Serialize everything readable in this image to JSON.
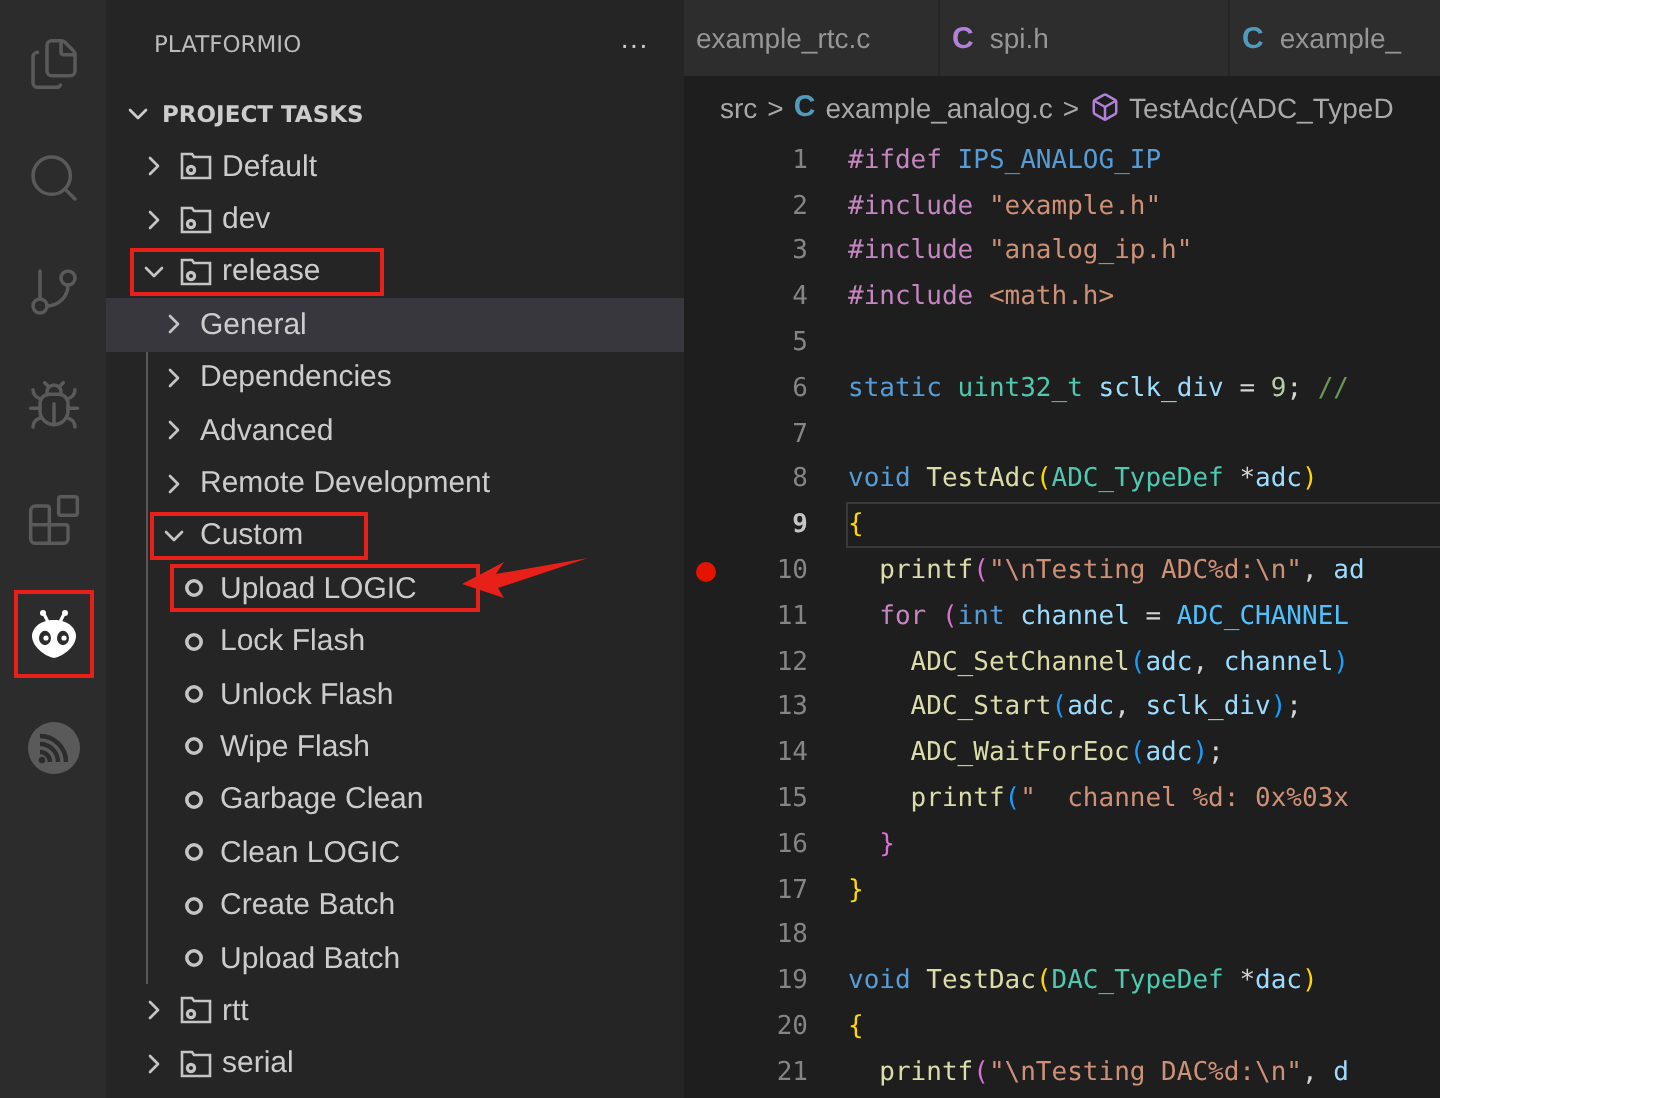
{
  "activity_bar": [
    {
      "selected": false,
      "highlighted": false
    },
    {
      "selected": false,
      "highlighted": false
    },
    {
      "selected": false,
      "highlighted": false
    },
    {
      "selected": false,
      "highlighted": false
    },
    {
      "selected": false,
      "highlighted": false
    },
    {
      "selected": true,
      "highlighted": true
    },
    {
      "selected": false,
      "highlighted": false
    }
  ],
  "sidebar": {
    "title": "PLATFORMIO",
    "more": "···",
    "section": {
      "title": "PROJECT TASKS",
      "expanded": true,
      "items": [
        {
          "kind": "env",
          "label": "Default",
          "expanded": false,
          "selected": false,
          "highlighted": false
        },
        {
          "kind": "env",
          "label": "dev",
          "expanded": false,
          "selected": false,
          "highlighted": false
        },
        {
          "kind": "env",
          "label": "release",
          "expanded": true,
          "selected": false,
          "highlighted": true,
          "children": [
            {
              "kind": "group",
              "label": "General",
              "expanded": false,
              "selected": true,
              "highlighted": false
            },
            {
              "kind": "group",
              "label": "Dependencies",
              "expanded": false,
              "selected": false,
              "highlighted": false
            },
            {
              "kind": "group",
              "label": "Advanced",
              "expanded": false,
              "selected": false,
              "highlighted": false
            },
            {
              "kind": "group",
              "label": "Remote Development",
              "expanded": false,
              "selected": false,
              "highlighted": false
            },
            {
              "kind": "group",
              "label": "Custom",
              "expanded": true,
              "selected": false,
              "highlighted": true,
              "children": [
                {
                  "kind": "task",
                  "label": "Upload LOGIC",
                  "selected": false,
                  "highlighted": true,
                  "arrow": true
                },
                {
                  "kind": "task",
                  "label": "Lock Flash",
                  "selected": false,
                  "highlighted": false
                },
                {
                  "kind": "task",
                  "label": "Unlock Flash",
                  "selected": false,
                  "highlighted": false
                },
                {
                  "kind": "task",
                  "label": "Wipe Flash",
                  "selected": false,
                  "highlighted": false
                },
                {
                  "kind": "task",
                  "label": "Garbage Clean",
                  "selected": false,
                  "highlighted": false
                },
                {
                  "kind": "task",
                  "label": "Clean LOGIC",
                  "selected": false,
                  "highlighted": false
                },
                {
                  "kind": "task",
                  "label": "Create Batch",
                  "selected": false,
                  "highlighted": false
                },
                {
                  "kind": "task",
                  "label": "Upload Batch",
                  "selected": false,
                  "highlighted": false
                }
              ]
            }
          ]
        },
        {
          "kind": "env",
          "label": "rtt",
          "expanded": false,
          "selected": false,
          "highlighted": false
        },
        {
          "kind": "env",
          "label": "serial",
          "expanded": false,
          "selected": false,
          "highlighted": false
        }
      ]
    }
  },
  "editor": {
    "tabs": [
      {
        "label": "example_rtc.c",
        "icon": false
      },
      {
        "label": "spi.h",
        "icon": true,
        "icon_text": "C",
        "color": "#b180d7"
      },
      {
        "label": "example_",
        "icon": true,
        "icon_text": "C",
        "color": "#519aba"
      }
    ],
    "breadcrumb": {
      "folder": "src",
      "separator": ">",
      "file_icon": "C",
      "file": "example_analog.c",
      "symbol": "TestAdc(ADC_TypeD"
    },
    "lines": [
      {
        "number": "1",
        "breakpoint": false,
        "current": false,
        "tokens": [
          {
            "kind": "preproc",
            "text": "#ifdef "
          },
          {
            "kind": "macro",
            "text": "IPS_ANALOG_IP"
          }
        ]
      },
      {
        "number": "2",
        "breakpoint": false,
        "current": false,
        "tokens": [
          {
            "kind": "preproc",
            "text": "#include "
          },
          {
            "kind": "string",
            "text": "\"example.h\""
          }
        ]
      },
      {
        "number": "3",
        "breakpoint": false,
        "current": false,
        "tokens": [
          {
            "kind": "preproc",
            "text": "#include "
          },
          {
            "kind": "string",
            "text": "\"analog_ip.h\""
          }
        ]
      },
      {
        "number": "4",
        "breakpoint": false,
        "current": false,
        "tokens": [
          {
            "kind": "preproc",
            "text": "#include "
          },
          {
            "kind": "string",
            "text": "<math.h>"
          }
        ]
      },
      {
        "number": "5",
        "breakpoint": false,
        "current": false
      },
      {
        "number": "6",
        "breakpoint": false,
        "current": false,
        "tokens": [
          {
            "kind": "keyword",
            "text": "static "
          },
          {
            "kind": "type",
            "text": "uint32_t "
          },
          {
            "kind": "variable",
            "text": "sclk_div"
          },
          {
            "kind": "plain",
            "text": " = "
          },
          {
            "kind": "number",
            "text": "9"
          },
          {
            "kind": "plain",
            "text": "; "
          },
          {
            "kind": "comment",
            "text": "//"
          }
        ]
      },
      {
        "number": "7",
        "breakpoint": false,
        "current": false
      },
      {
        "number": "8",
        "breakpoint": false,
        "current": false,
        "tokens": [
          {
            "kind": "keyword",
            "text": "void "
          },
          {
            "kind": "function",
            "text": "TestAdc"
          },
          {
            "kind": "bracket1",
            "text": "("
          },
          {
            "kind": "type",
            "text": "ADC_TypeDef "
          },
          {
            "kind": "plain",
            "text": "*"
          },
          {
            "kind": "variable",
            "text": "adc"
          },
          {
            "kind": "bracket1",
            "text": ")"
          }
        ]
      },
      {
        "number": "9",
        "breakpoint": false,
        "current": true,
        "tokens": [
          {
            "kind": "bracket1",
            "text": "{"
          }
        ]
      },
      {
        "number": "10",
        "breakpoint": true,
        "current": false,
        "tokens": [
          {
            "kind": "function",
            "text": "  printf"
          },
          {
            "kind": "bracket2",
            "text": "("
          },
          {
            "kind": "string",
            "text": "\"\\nTesting ADC%d:\\n\""
          },
          {
            "kind": "plain",
            "text": ", "
          },
          {
            "kind": "variable",
            "text": "ad"
          }
        ]
      },
      {
        "number": "11",
        "breakpoint": false,
        "current": false,
        "tokens": [
          {
            "kind": "control",
            "text": "  for "
          },
          {
            "kind": "bracket2",
            "text": "("
          },
          {
            "kind": "keyword",
            "text": "int "
          },
          {
            "kind": "variable",
            "text": "channel"
          },
          {
            "kind": "plain",
            "text": " = "
          },
          {
            "kind": "constant",
            "text": "ADC_CHANNEL"
          }
        ]
      },
      {
        "number": "12",
        "breakpoint": false,
        "current": false,
        "tokens": [
          {
            "kind": "function",
            "text": "    ADC_SetChannel"
          },
          {
            "kind": "bracket3",
            "text": "("
          },
          {
            "kind": "variable",
            "text": "adc"
          },
          {
            "kind": "plain",
            "text": ", "
          },
          {
            "kind": "variable",
            "text": "channel"
          },
          {
            "kind": "bracket3",
            "text": ")"
          }
        ]
      },
      {
        "number": "13",
        "breakpoint": false,
        "current": false,
        "tokens": [
          {
            "kind": "function",
            "text": "    ADC_Start"
          },
          {
            "kind": "bracket3",
            "text": "("
          },
          {
            "kind": "variable",
            "text": "adc"
          },
          {
            "kind": "plain",
            "text": ", "
          },
          {
            "kind": "variable",
            "text": "sclk_div"
          },
          {
            "kind": "bracket3",
            "text": ")"
          },
          {
            "kind": "plain",
            "text": ";"
          }
        ]
      },
      {
        "number": "14",
        "breakpoint": false,
        "current": false,
        "tokens": [
          {
            "kind": "function",
            "text": "    ADC_WaitForEoc"
          },
          {
            "kind": "bracket3",
            "text": "("
          },
          {
            "kind": "variable",
            "text": "adc"
          },
          {
            "kind": "bracket3",
            "text": ")"
          },
          {
            "kind": "plain",
            "text": ";"
          }
        ]
      },
      {
        "number": "15",
        "breakpoint": false,
        "current": false,
        "tokens": [
          {
            "kind": "function",
            "text": "    printf"
          },
          {
            "kind": "bracket3",
            "text": "("
          },
          {
            "kind": "string",
            "text": "\"  channel %d: 0x%03x"
          }
        ]
      },
      {
        "number": "16",
        "breakpoint": false,
        "current": false,
        "tokens": [
          {
            "kind": "bracket2",
            "text": "  }"
          }
        ]
      },
      {
        "number": "17",
        "breakpoint": false,
        "current": false,
        "tokens": [
          {
            "kind": "bracket1",
            "text": "}"
          }
        ]
      },
      {
        "number": "18",
        "breakpoint": false,
        "current": false
      },
      {
        "number": "19",
        "breakpoint": false,
        "current": false,
        "tokens": [
          {
            "kind": "keyword",
            "text": "void "
          },
          {
            "kind": "function",
            "text": "TestDac"
          },
          {
            "kind": "bracket1",
            "text": "("
          },
          {
            "kind": "type",
            "text": "DAC_TypeDef "
          },
          {
            "kind": "plain",
            "text": "*"
          },
          {
            "kind": "variable",
            "text": "dac"
          },
          {
            "kind": "bracket1",
            "text": ")"
          }
        ]
      },
      {
        "number": "20",
        "breakpoint": false,
        "current": false,
        "tokens": [
          {
            "kind": "bracket1",
            "text": "{"
          }
        ]
      },
      {
        "number": "21",
        "breakpoint": false,
        "current": false,
        "tokens": [
          {
            "kind": "function",
            "text": "  printf"
          },
          {
            "kind": "bracket2",
            "text": "("
          },
          {
            "kind": "string",
            "text": "\"\\nTesting DAC%d:\\n\""
          },
          {
            "kind": "plain",
            "text": ", "
          },
          {
            "kind": "variable",
            "text": "d"
          }
        ]
      }
    ]
  }
}
